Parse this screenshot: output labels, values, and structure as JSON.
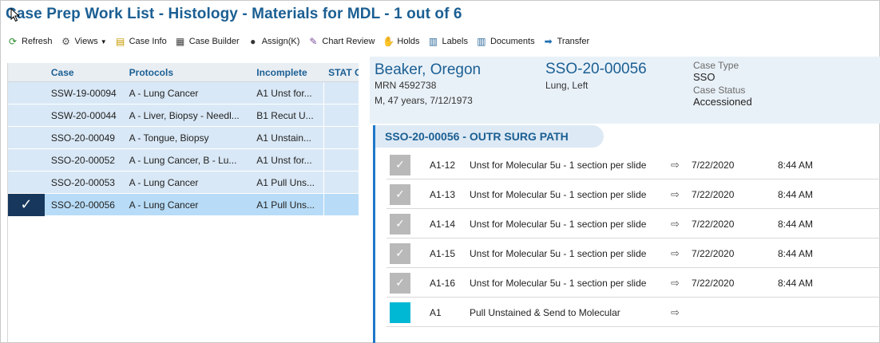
{
  "window": {
    "title": "Case Prep Work List - Histology - Materials for MDL - 1 out of 6"
  },
  "toolbar": [
    {
      "id": "refresh",
      "label": "Refresh",
      "icon": "refresh-icon",
      "glyph": "⟳",
      "color": "#2d8a2d"
    },
    {
      "id": "views",
      "label": "Views",
      "icon": "gears-icon",
      "glyph": "⚙",
      "color": "#555555",
      "dropdown": true
    },
    {
      "id": "case-info",
      "label": "Case Info",
      "icon": "case-info-icon",
      "glyph": "▤",
      "color": "#c79a00"
    },
    {
      "id": "case-builder",
      "label": "Case Builder",
      "icon": "case-builder-icon",
      "glyph": "▦",
      "color": "#444444"
    },
    {
      "id": "assign",
      "label": "Assign(K)",
      "icon": "person-icon",
      "glyph": "●",
      "color": "#333333"
    },
    {
      "id": "chart-review",
      "label": "Chart Review",
      "icon": "chart-review-icon",
      "glyph": "✎",
      "color": "#7a4a9a"
    },
    {
      "id": "holds",
      "label": "Holds",
      "icon": "hand-icon",
      "glyph": "✋",
      "color": "#555555"
    },
    {
      "id": "labels",
      "label": "Labels",
      "icon": "labels-icon",
      "glyph": "▥",
      "color": "#2f6a9a"
    },
    {
      "id": "documents",
      "label": "Documents",
      "icon": "documents-icon",
      "glyph": "▥",
      "color": "#2f6a9a"
    },
    {
      "id": "transfer",
      "label": "Transfer",
      "icon": "arrow-right-icon",
      "glyph": "➡",
      "color": "#1f6fb2"
    }
  ],
  "list": {
    "headers": {
      "case": "Case",
      "protocols": "Protocols",
      "incomplete": "Incomplete",
      "stat": "STAT Ca"
    },
    "rows": [
      {
        "case": "SSW-19-00094",
        "protocols": "A - Lung Cancer",
        "incomplete": "A1 Unst for...",
        "selected": false
      },
      {
        "case": "SSW-20-00044",
        "protocols": "A - Liver, Biopsy - Needl...",
        "incomplete": "B1 Recut U...",
        "selected": false
      },
      {
        "case": "SSO-20-00049",
        "protocols": "A - Tongue, Biopsy",
        "incomplete": "A1 Unstain...",
        "selected": false
      },
      {
        "case": "SSO-20-00052",
        "protocols": "A - Lung Cancer, B - Lu...",
        "incomplete": "A1 Unst for...",
        "selected": false
      },
      {
        "case": "SSO-20-00053",
        "protocols": "A - Lung Cancer",
        "incomplete": "A1 Pull Uns...",
        "selected": false
      },
      {
        "case": "SSO-20-00056",
        "protocols": "A - Lung Cancer",
        "incomplete": "A1 Pull Uns...",
        "selected": true
      }
    ],
    "selected_check": "✓"
  },
  "patient": {
    "name": "Beaker, Oregon",
    "mrn": "MRN 4592738",
    "demographics": "M, 47 years, 7/12/1973",
    "case_number": "SSO-20-00056",
    "site": "Lung, Left",
    "case_type_label": "Case Type",
    "case_type": "SSO",
    "case_status_label": "Case Status",
    "case_status": "Accessioned"
  },
  "case_section": {
    "title": "SSO-20-00056 - OUTR SURG PATH",
    "tasks": [
      {
        "block": "A1-12",
        "desc": "Unst for Molecular 5u - 1 section per slide",
        "date": "7/22/2020",
        "time": "8:44 AM",
        "done": true
      },
      {
        "block": "A1-13",
        "desc": "Unst for Molecular 5u - 1 section per slide",
        "date": "7/22/2020",
        "time": "8:44 AM",
        "done": true
      },
      {
        "block": "A1-14",
        "desc": "Unst for Molecular 5u - 1 section per slide",
        "date": "7/22/2020",
        "time": "8:44 AM",
        "done": true
      },
      {
        "block": "A1-15",
        "desc": "Unst for Molecular 5u - 1 section per slide",
        "date": "7/22/2020",
        "time": "8:44 AM",
        "done": true
      },
      {
        "block": "A1-16",
        "desc": "Unst for Molecular 5u - 1 section per slide",
        "date": "7/22/2020",
        "time": "8:44 AM",
        "done": true
      },
      {
        "block": "A1",
        "desc": "Pull Unstained & Send to Molecular",
        "date": "",
        "time": "",
        "done": false
      }
    ],
    "ext_glyph": "⇨"
  }
}
